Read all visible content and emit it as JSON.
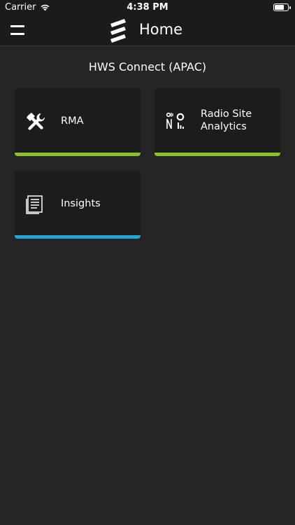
{
  "status_bar": {
    "carrier": "Carrier",
    "time": "4:38 PM",
    "battery_level": 0.7
  },
  "nav_bar": {
    "title": "Home"
  },
  "main": {
    "section_title": "HWS Connect (APAC)",
    "tiles": [
      {
        "label": "RMA",
        "icon": "tools-icon",
        "accent": "#8dc21f"
      },
      {
        "label": "Radio Site\nAnalytics",
        "icon": "radio-site-analytics-icon",
        "accent": "#8dc21f"
      },
      {
        "label": "Insights",
        "icon": "document-icon",
        "accent": "#1ea6d6"
      }
    ]
  },
  "colors": {
    "background": "#252525",
    "tile": "#1c1c1c",
    "green_accent": "#8dc21f",
    "blue_accent": "#1ea6d6"
  }
}
